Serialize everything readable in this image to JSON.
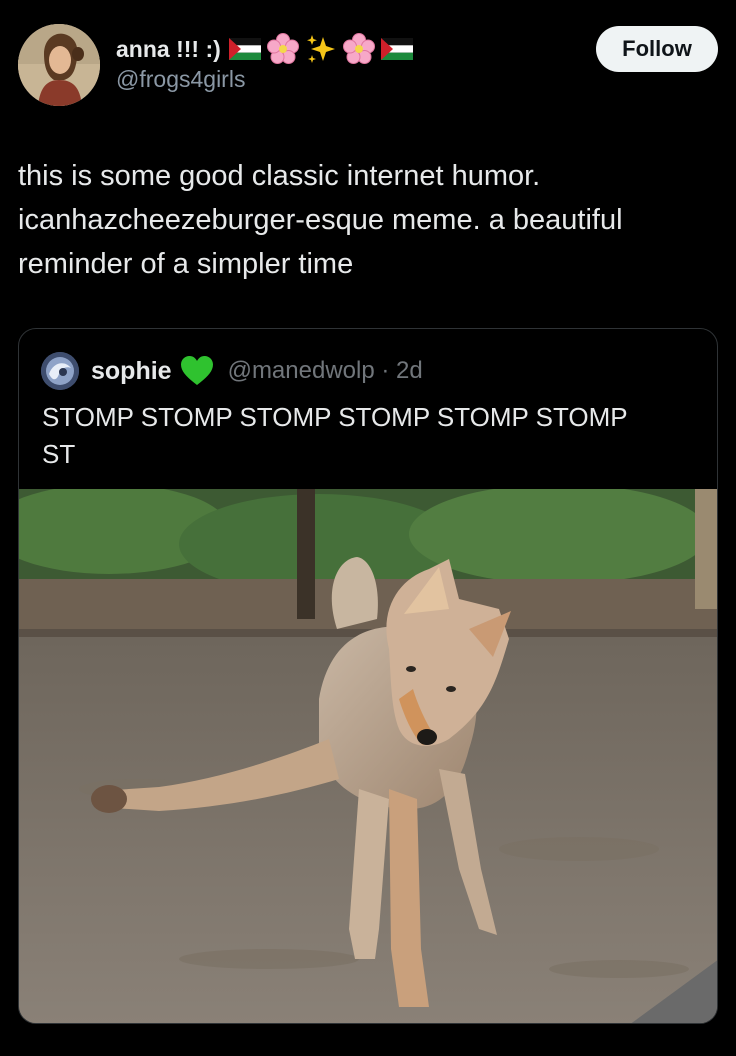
{
  "header": {
    "display_name": "anna !!! :)",
    "handle": "@frogs4girls",
    "follow_label": "Follow",
    "name_emojis": [
      "flag",
      "cherry-blossom",
      "sparkles",
      "cherry-blossom",
      "flag"
    ]
  },
  "tweet": {
    "text": "this is some good classic internet humor.\nicanhazcheezeburger-esque meme. a beautiful\nreminder of a simpler time"
  },
  "quote": {
    "display_name": "sophie",
    "name_emoji": "green-heart",
    "handle_time": "@manedwolp · 2d",
    "text": "STOMP STOMP STOMP STOMP STOMP STOMP\nST"
  },
  "colors": {
    "background": "#000000",
    "text": "#e7e9ea",
    "muted": "#8b98a5",
    "border": "#2f3336",
    "button_bg": "#eff3f4",
    "heart": "#2fc22f"
  }
}
